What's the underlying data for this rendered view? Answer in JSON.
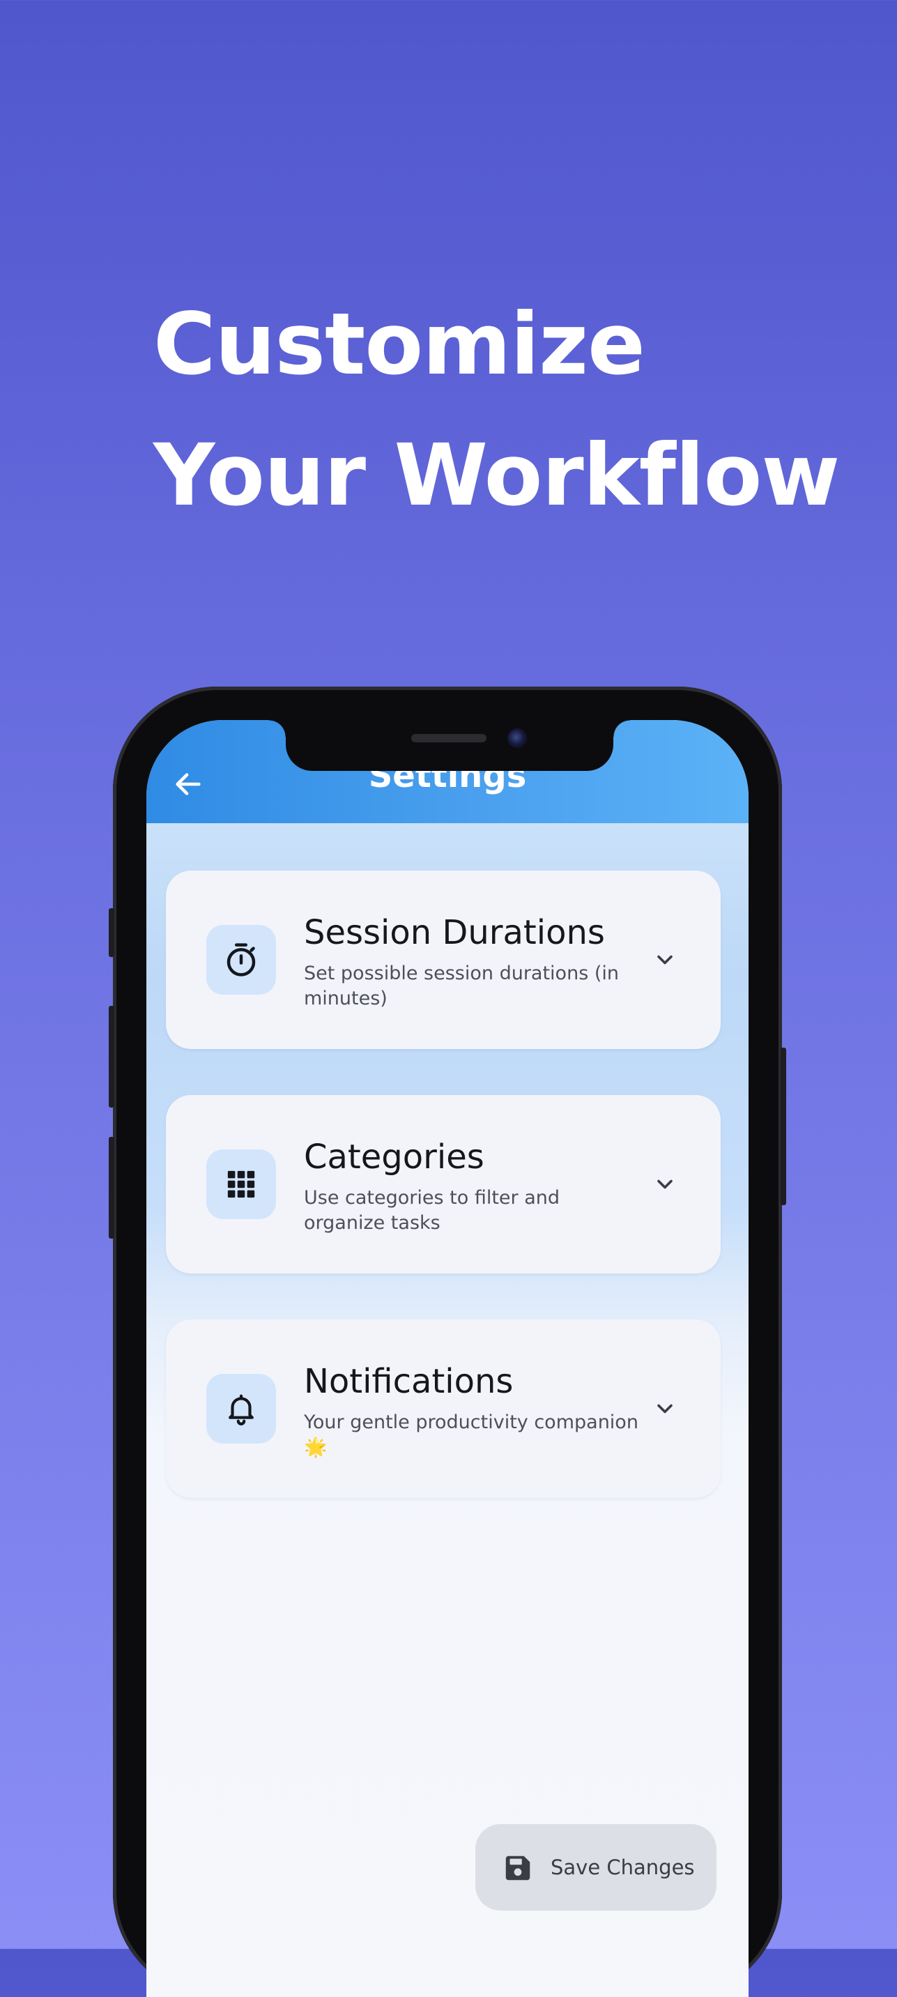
{
  "headline": {
    "line1": "Customize",
    "line2": "Your Workflow"
  },
  "header": {
    "title": "Settings",
    "back_icon": "arrow-left-icon"
  },
  "cards": [
    {
      "icon": "stopwatch-icon",
      "title": "Session Durations",
      "subtitle": "Set possible session durations (in minutes)"
    },
    {
      "icon": "grid-icon",
      "title": "Categories",
      "subtitle": "Use categories to filter and organize tasks"
    },
    {
      "icon": "bell-icon",
      "title": "Notifications",
      "subtitle": "Your gentle productivity companion 🌟"
    }
  ],
  "save_button": {
    "label": "Save Changes",
    "icon": "floppy-disk-icon"
  },
  "colors": {
    "background_top": "#5056cc",
    "background_bottom": "#8a8ef5",
    "header_gradient_start": "#2f8be4",
    "header_gradient_end": "#5bb2f6",
    "card_background": "#f3f4fa",
    "icon_tile": "#d3e5fb",
    "save_button": "#dcdfe6"
  }
}
